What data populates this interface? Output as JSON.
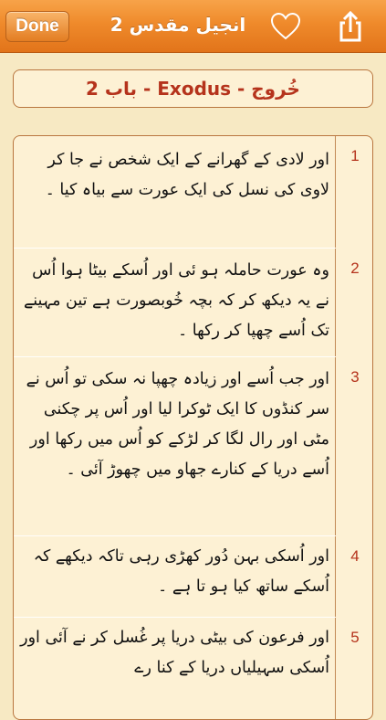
{
  "navbar": {
    "done_label": "Done",
    "title": "انجیل مقدس 2",
    "heart_icon": "heart-outline-icon",
    "share_icon": "share-icon"
  },
  "chapter": {
    "title": "خُروج - Exodus - باب 2"
  },
  "colors": {
    "accent": "#ef8a2b",
    "verse_number": "#b5331c",
    "background": "#f7e9c3"
  },
  "verses": [
    {
      "number": "1",
      "text": "اور لادی کے گھرانے کے ایک شخص نے جا کر لاوی کی نسل کی ایک عورت سے بیاہ کیا ۔"
    },
    {
      "number": "2",
      "text": "وہ عورت حاملہ ہو ئی اور اُسکے بیٹا ہوا اُس نے یہ دیکھ کر کہ بچہ خُوبصورت ہے تین مہینے تک اُسے چھپا کر رکھا ۔"
    },
    {
      "number": "3",
      "text": "اور جب اُسے اور زیادہ چھپا نہ سکی تو اُس نے سر کنڈوں کا ایک ٹوکرا لیا اور اُس پر چکنی مٹی اور رال لگا کر لڑکے کو اُس میں رکھا اور اُسے دریا کے کنارے جھاو میں چھوڑ آئی ۔"
    },
    {
      "number": "4",
      "text": "اور اُسکی بہن دُور کھڑی رہی تاکہ دیکھے کہ اُسکے ساتھ کیا ہو تا ہے ۔"
    },
    {
      "number": "5",
      "text": "اور فرعون کی بیٹی دریا پر غُسل کر نے آئی اور اُسکی سہیلیاں دریا کے کنا رے"
    }
  ]
}
